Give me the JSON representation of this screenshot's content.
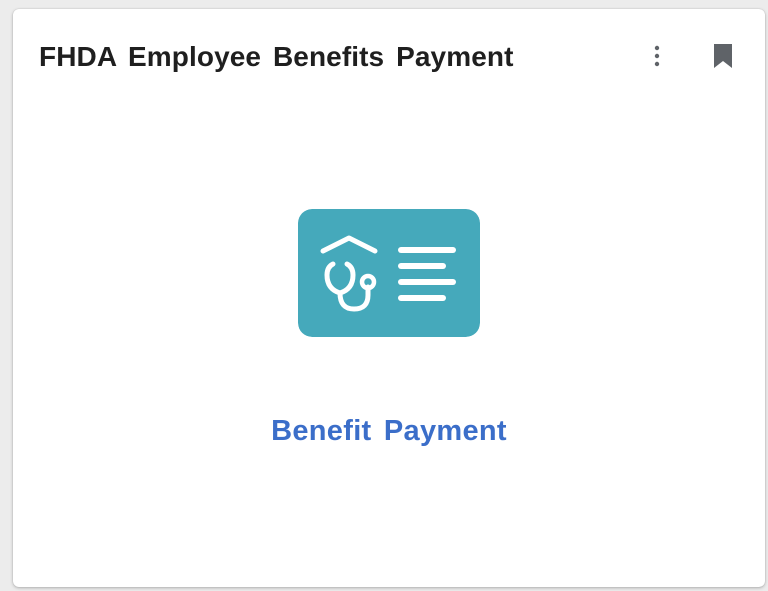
{
  "card": {
    "title": "FHDA Employee Benefits Payment",
    "menu_icon": "more-vertical-icon",
    "bookmark_icon": "bookmark-icon"
  },
  "tile": {
    "icon": "health-benefits-card-icon",
    "label": "Benefit Payment"
  },
  "colors": {
    "tile_bg": "#45a9bb",
    "link": "#3b6ec9",
    "title": "#1f1f1f",
    "icon_gray": "#5f6368"
  }
}
